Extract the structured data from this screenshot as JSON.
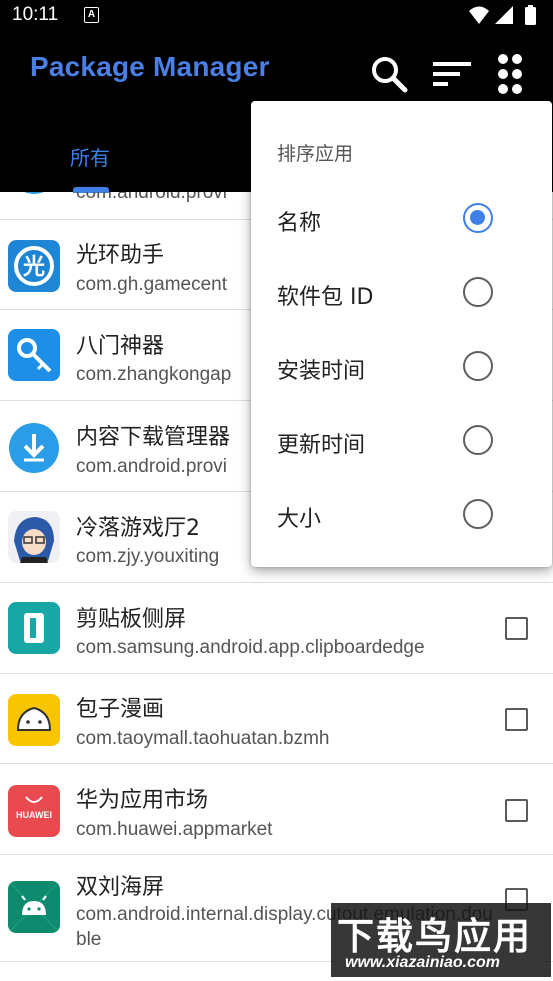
{
  "status_bar": {
    "time": "10:11",
    "notification_glyph": "A"
  },
  "app_bar": {
    "title": "Package Manager",
    "icons": [
      "search-icon",
      "sort-icon",
      "grid-menu-icon"
    ]
  },
  "tabs": [
    {
      "label": "所有",
      "active": true
    }
  ],
  "apps": [
    {
      "name": "",
      "package": "com.android.provi",
      "icon": "partial-app-icon",
      "checkbox": false
    },
    {
      "name": "光环助手",
      "package": "com.gh.gamecent",
      "icon": "guanghuan-app-icon",
      "checkbox": false
    },
    {
      "name": "八门神器",
      "package": "com.zhangkongap",
      "icon": "bamen-key-app-icon",
      "checkbox": false
    },
    {
      "name": "内容下载管理器",
      "package": "com.android.provi",
      "icon": "download-app-icon",
      "checkbox": false
    },
    {
      "name": "冷落游戏厅2",
      "package": "com.zjy.youxiting",
      "icon": "anime-avatar-app-icon",
      "checkbox": false
    },
    {
      "name": "剪贴板侧屏",
      "package": "com.samsung.android.app.clipboardedge",
      "icon": "clipboard-app-icon",
      "checkbox": true
    },
    {
      "name": "包子漫画",
      "package": "com.taoymall.taohuatan.bzmh",
      "icon": "baozi-app-icon",
      "checkbox": true
    },
    {
      "name": "华为应用市场",
      "package": "com.huawei.appmarket",
      "icon": "huawei-app-icon",
      "checkbox": true,
      "icon_text": "HUAWEI"
    },
    {
      "name": "双刘海屏",
      "package": "com.android.internal.display.cutout.emulation.double",
      "icon": "android-app-icon",
      "checkbox": true
    }
  ],
  "sort_menu": {
    "title": "排序应用",
    "options": [
      {
        "label": "名称",
        "selected": true
      },
      {
        "label": "软件包 ID",
        "selected": false
      },
      {
        "label": "安装时间",
        "selected": false
      },
      {
        "label": "更新时间",
        "selected": false
      },
      {
        "label": "大小",
        "selected": false
      }
    ]
  },
  "watermark": {
    "text": "下载鸟应用",
    "url": "www.xiazainiao.com"
  },
  "colors": {
    "accent": "#3f7fe8",
    "title": "#4a7fe6",
    "app_bar_bg": "#000000"
  }
}
